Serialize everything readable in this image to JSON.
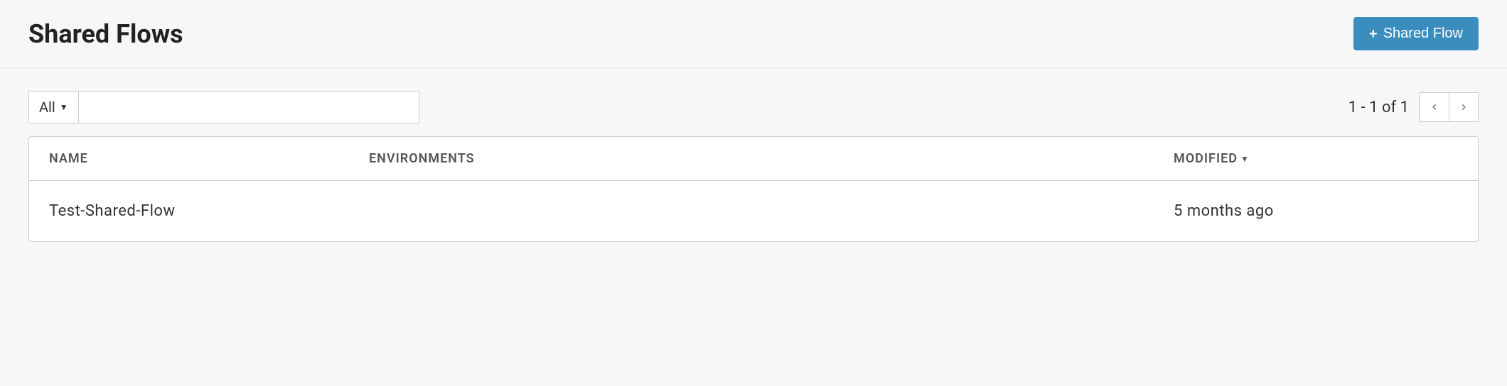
{
  "header": {
    "title": "Shared Flows",
    "add_button_label": "Shared Flow"
  },
  "toolbar": {
    "filter_label": "All",
    "search_value": "",
    "page_info": "1 - 1 of 1"
  },
  "table": {
    "columns": {
      "name": "NAME",
      "environments": "ENVIRONMENTS",
      "modified": "MODIFIED"
    },
    "sort_indicator": "▼",
    "rows": [
      {
        "name": "Test-Shared-Flow",
        "environments": "",
        "modified": "5 months ago"
      }
    ]
  }
}
